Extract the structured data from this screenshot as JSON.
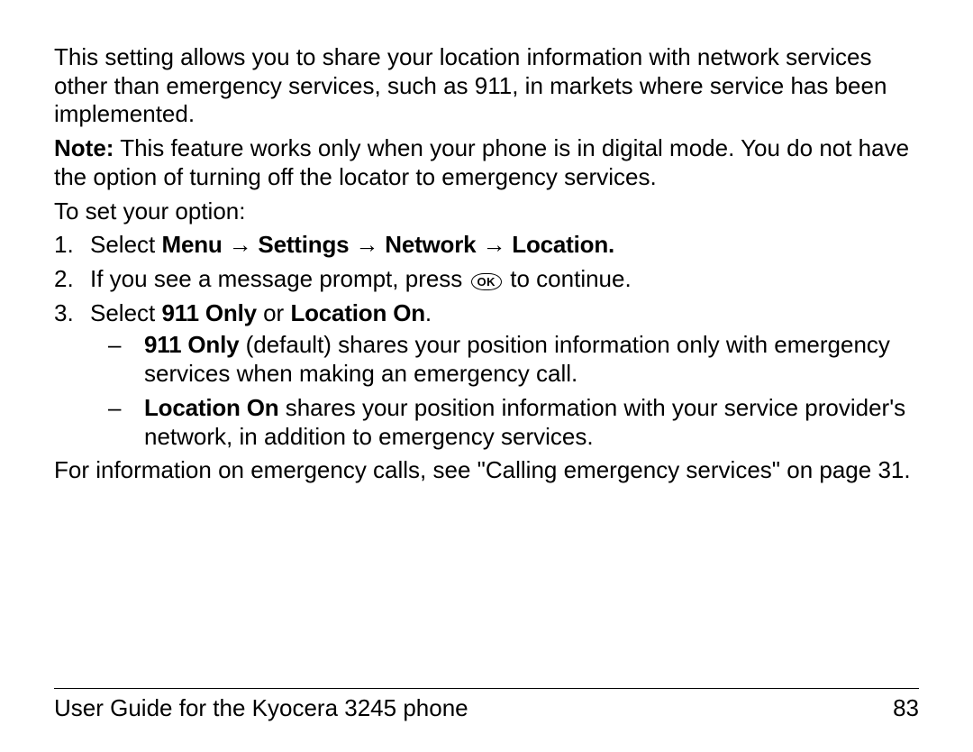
{
  "intro": "This setting allows you to share your location information with network services other than emergency services, such as 911, in markets where service has been implemented.",
  "note_label": "Note:",
  "note_body": " This feature works only when your phone is in digital mode. You do not have the option of turning off the locator to emergency services.",
  "to_set": "To set your option:",
  "step1_prefix": "Select ",
  "step1_bold": "Menu → Settings → Network → Location.",
  "step2_prefix": "If you see a message prompt, press ",
  "ok_label": "OK",
  "step2_suffix": " to continue.",
  "step3_prefix": "Select ",
  "step3_opt1": "911 Only",
  "step3_or": " or ",
  "step3_opt2": "Location On",
  "step3_suffix": ".",
  "sub1_bold": "911 Only",
  "sub1_rest": " (default) shares your position information only with emergency services when making an emergency call.",
  "sub2_bold": "Location On",
  "sub2_rest": " shares your position information with your service provider's network, in addition to emergency services.",
  "closing": "For information on emergency calls, see \"Calling emergency services\" on page 31.",
  "footer_title": "User Guide for the Kyocera 3245 phone",
  "footer_page": "83"
}
